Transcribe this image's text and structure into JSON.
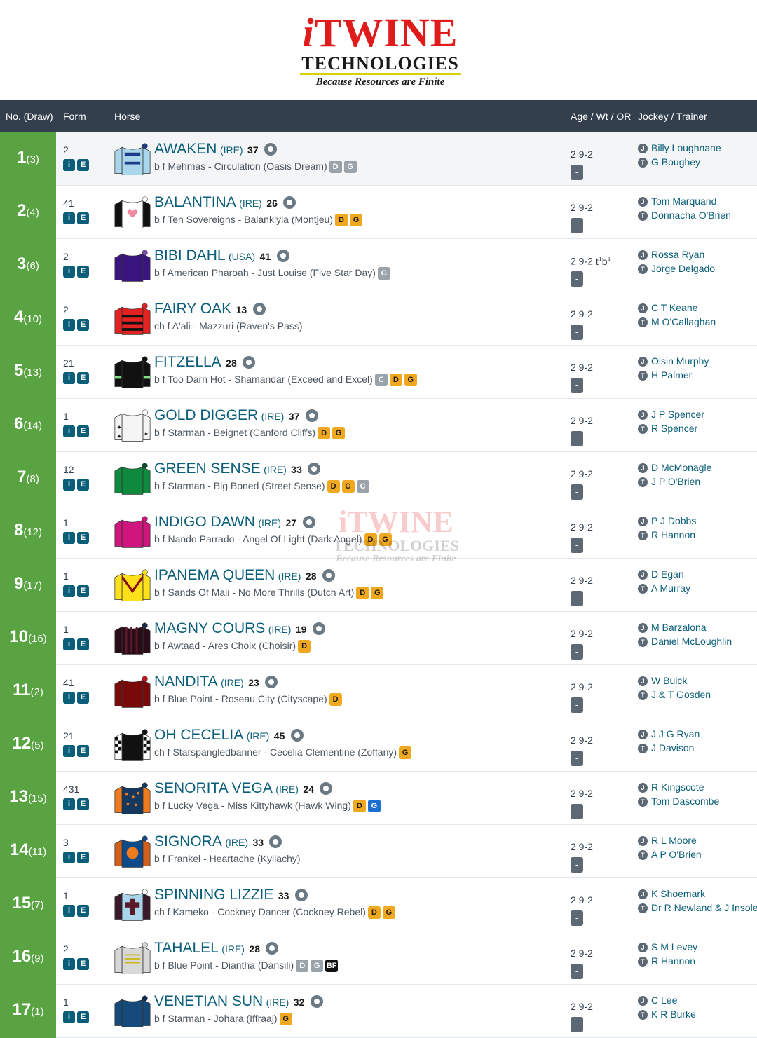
{
  "logo": {
    "main_prefix": "i",
    "main": "TWINE",
    "sub": "TECHNOLOGIES",
    "tagline": "Because Resources are Finite"
  },
  "header": {
    "no_draw": "No. (Draw)",
    "form": "Form",
    "horse": "Horse",
    "age_wt_or": "Age / Wt / OR",
    "jockey_trainer": "Jockey / Trainer"
  },
  "icons": {
    "i_label": "i",
    "e_label": "E",
    "jockey_icon": "J",
    "trainer_icon": "T",
    "or_value": "-"
  },
  "colors": {
    "number_cell": "#5aa343",
    "header_bg": "#333f4c",
    "link_teal": "#0a5e7a",
    "badge_orange": "#f0a820",
    "badge_grey": "#9aa3aa",
    "badge_blue": "#1a6fd0"
  },
  "runners": [
    {
      "num": "1",
      "draw": "(3)",
      "form": "2",
      "name": "AWAKEN",
      "country": "(IRE)",
      "rating": "37",
      "breeding": "b f Mehmas - Circulation (Oasis Dream)",
      "badges": [
        {
          "t": "D",
          "c": "g"
        },
        {
          "t": "G",
          "c": "g"
        }
      ],
      "age_wt": "2 9-2",
      "headgear": "",
      "jockey": "Billy Loughnane",
      "trainer": "G Boughey",
      "silk": {
        "body": "#a9d6ea",
        "sleeve": "#a9d6ea",
        "cap": "#1e3a8a",
        "accent": "#1e3a8a",
        "pattern": "sash"
      }
    },
    {
      "num": "2",
      "draw": "(4)",
      "form": "41",
      "name": "BALANTINA",
      "country": "(IRE)",
      "rating": "26",
      "breeding": "b f Ten Sovereigns - Balankiyla (Montjeu)",
      "badges": [
        {
          "t": "D",
          "c": "o"
        },
        {
          "t": "G",
          "c": "o"
        }
      ],
      "age_wt": "2 9-2",
      "headgear": "",
      "jockey": "Tom Marquand",
      "trainer": "Donnacha O'Brien",
      "silk": {
        "body": "#ffffff",
        "sleeve": "#111111",
        "cap": "#ffffff",
        "accent": "#f08aa0",
        "pattern": "heart"
      }
    },
    {
      "num": "3",
      "draw": "(6)",
      "form": "2",
      "name": "BIBI DAHL",
      "country": "(USA)",
      "rating": "41",
      "breeding": "b f American Pharoah - Just Louise (Five Star Day)",
      "badges": [
        {
          "t": "G",
          "c": "g"
        }
      ],
      "age_wt": "2 9-2",
      "headgear": "t1b1",
      "jockey": "Rossa Ryan",
      "trainer": "Jorge Delgado",
      "silk": {
        "body": "#3a1580",
        "sleeve": "#3a1580",
        "cap": "#7a4ab0",
        "accent": "#ffffff",
        "pattern": "plain"
      }
    },
    {
      "num": "4",
      "draw": "(10)",
      "form": "2",
      "name": "FAIRY OAK",
      "country": "",
      "rating": "13",
      "breeding": "ch f A'ali - Mazzuri (Raven's Pass)",
      "badges": [],
      "age_wt": "2 9-2",
      "headgear": "",
      "jockey": "C T Keane",
      "trainer": "M O'Callaghan",
      "silk": {
        "body": "#e52222",
        "sleeve": "#e52222",
        "cap": "#e52222",
        "accent": "#111111",
        "pattern": "hoops"
      }
    },
    {
      "num": "5",
      "draw": "(13)",
      "form": "21",
      "name": "FITZELLA",
      "country": "",
      "rating": "28",
      "breeding": "b f Too Darn Hot - Shamandar (Exceed and Excel)",
      "badges": [
        {
          "t": "C",
          "c": "g"
        },
        {
          "t": "D",
          "c": "o"
        },
        {
          "t": "G",
          "c": "o"
        }
      ],
      "age_wt": "2 9-2",
      "headgear": "",
      "jockey": "Oisin Murphy",
      "trainer": "H Palmer",
      "silk": {
        "body": "#111111",
        "sleeve": "#111111",
        "cap": "#111111",
        "accent": "#7fe08a",
        "pattern": "armlets"
      }
    },
    {
      "num": "6",
      "draw": "(14)",
      "form": "1",
      "name": "GOLD DIGGER",
      "country": "(IRE)",
      "rating": "37",
      "breeding": "b f Starman - Beignet (Canford Cliffs)",
      "badges": [
        {
          "t": "D",
          "c": "o"
        },
        {
          "t": "G",
          "c": "o"
        }
      ],
      "age_wt": "2 9-2",
      "headgear": "",
      "jockey": "J P Spencer",
      "trainer": "R Spencer",
      "silk": {
        "body": "#f5f5f5",
        "sleeve": "#f5f5f5",
        "cap": "#ffffff",
        "accent": "#111111",
        "pattern": "stars"
      }
    },
    {
      "num": "7",
      "draw": "(8)",
      "form": "12",
      "name": "GREEN SENSE",
      "country": "(IRE)",
      "rating": "33",
      "breeding": "b f Starman - Big Boned (Street Sense)",
      "badges": [
        {
          "t": "D",
          "c": "o"
        },
        {
          "t": "G",
          "c": "o"
        },
        {
          "t": "C",
          "c": "g"
        }
      ],
      "age_wt": "2 9-2",
      "headgear": "",
      "jockey": "D McMonagle",
      "trainer": "J P O'Brien",
      "silk": {
        "body": "#0d8a3e",
        "sleeve": "#0d8a3e",
        "cap": "#0b4f2a",
        "accent": "#0b4f2a",
        "pattern": "plain"
      }
    },
    {
      "num": "8",
      "draw": "(12)",
      "form": "1",
      "name": "INDIGO DAWN",
      "country": "(IRE)",
      "rating": "27",
      "breeding": "b f Nando Parrado - Angel Of Light (Dark Angel)",
      "badges": [
        {
          "t": "D",
          "c": "o"
        },
        {
          "t": "G",
          "c": "o"
        }
      ],
      "age_wt": "2 9-2",
      "headgear": "",
      "jockey": "P J Dobbs",
      "trainer": "R Hannon",
      "silk": {
        "body": "#d0157f",
        "sleeve": "#d0157f",
        "cap": "#d0157f",
        "accent": "#ffffff",
        "pattern": "plain"
      }
    },
    {
      "num": "9",
      "draw": "(17)",
      "form": "1",
      "name": "IPANEMA QUEEN",
      "country": "(IRE)",
      "rating": "28",
      "breeding": "b f Sands Of Mali - No More Thrills (Dutch Art)",
      "badges": [
        {
          "t": "D",
          "c": "o"
        },
        {
          "t": "G",
          "c": "o"
        }
      ],
      "age_wt": "2 9-2",
      "headgear": "",
      "jockey": "D Egan",
      "trainer": "A Murray",
      "silk": {
        "body": "#ffe11a",
        "sleeve": "#ffe11a",
        "cap": "#ffe11a",
        "accent": "#8a1010",
        "pattern": "chevron"
      }
    },
    {
      "num": "10",
      "draw": "(16)",
      "form": "1",
      "name": "MAGNY COURS",
      "country": "(IRE)",
      "rating": "19",
      "breeding": "b f Awtaad - Ares Choix (Choisir)",
      "badges": [
        {
          "t": "D",
          "c": "o"
        }
      ],
      "age_wt": "2 9-2",
      "headgear": "",
      "jockey": "M Barzalona",
      "trainer": "Daniel McLoughlin",
      "silk": {
        "body": "#2a0c18",
        "sleeve": "#2a0c18",
        "cap": "#1b2a4a",
        "accent": "#5a1a2a",
        "pattern": "stripes"
      }
    },
    {
      "num": "11",
      "draw": "(2)",
      "form": "41",
      "name": "NANDITA",
      "country": "(IRE)",
      "rating": "23",
      "breeding": "b f Blue Point - Roseau City (Cityscape)",
      "badges": [
        {
          "t": "D",
          "c": "o"
        }
      ],
      "age_wt": "2 9-2",
      "headgear": "",
      "jockey": "W Buick",
      "trainer": "J & T Gosden",
      "silk": {
        "body": "#7a0a0a",
        "sleeve": "#7a0a0a",
        "cap": "#c01818",
        "accent": "#7a0a0a",
        "pattern": "plain"
      }
    },
    {
      "num": "12",
      "draw": "(5)",
      "form": "21",
      "name": "OH CECELIA",
      "country": "(IRE)",
      "rating": "45",
      "breeding": "ch f Starspangledbanner - Cecelia Clementine (Zoffany)",
      "badges": [
        {
          "t": "G",
          "c": "o"
        }
      ],
      "age_wt": "2 9-2",
      "headgear": "",
      "jockey": "J J G Ryan",
      "trainer": "J Davison",
      "silk": {
        "body": "#111111",
        "sleeve": "#ffffff",
        "cap": "#111111",
        "accent": "#ffffff",
        "pattern": "check"
      }
    },
    {
      "num": "13",
      "draw": "(15)",
      "form": "431",
      "name": "SENORITA VEGA",
      "country": "(IRE)",
      "rating": "24",
      "breeding": "b f Lucky Vega - Miss Kittyhawk (Hawk Wing)",
      "badges": [
        {
          "t": "D",
          "c": "o"
        },
        {
          "t": "G",
          "c": "b"
        }
      ],
      "age_wt": "2 9-2",
      "headgear": "",
      "jockey": "R Kingscote",
      "trainer": "Tom Dascombe",
      "silk": {
        "body": "#14385e",
        "sleeve": "#f07a1e",
        "cap": "#14385e",
        "accent": "#f07a1e",
        "pattern": "spots"
      }
    },
    {
      "num": "14",
      "draw": "(11)",
      "form": "3",
      "name": "SIGNORA",
      "country": "(IRE)",
      "rating": "33",
      "breeding": "b f Frankel - Heartache (Kyllachy)",
      "badges": [],
      "age_wt": "2 9-2",
      "headgear": "",
      "jockey": "R L Moore",
      "trainer": "A P O'Brien",
      "silk": {
        "body": "#0d4a8a",
        "sleeve": "#d0601a",
        "cap": "#0d4a8a",
        "accent": "#f07a1e",
        "pattern": "disc"
      }
    },
    {
      "num": "15",
      "draw": "(7)",
      "form": "1",
      "name": "SPINNING LIZZIE",
      "country": "",
      "rating": "33",
      "breeding": "ch f Kameko - Cockney Dancer (Cockney Rebel)",
      "badges": [
        {
          "t": "D",
          "c": "o"
        },
        {
          "t": "G",
          "c": "o"
        }
      ],
      "age_wt": "2 9-2",
      "headgear": "",
      "jockey": "K Shoemark",
      "trainer": "Dr R Newland & J Insole",
      "silk": {
        "body": "#a9d6ea",
        "sleeve": "#3a1a2a",
        "cap": "#ffffff",
        "accent": "#5a1a2a",
        "pattern": "cross"
      }
    },
    {
      "num": "16",
      "draw": "(9)",
      "form": "2",
      "name": "TAHALEL",
      "country": "(IRE)",
      "rating": "28",
      "breeding": "b f Blue Point - Diantha (Dansili)",
      "badges": [
        {
          "t": "D",
          "c": "g"
        },
        {
          "t": "G",
          "c": "g"
        },
        {
          "t": "BF",
          "c": "k"
        }
      ],
      "age_wt": "2 9-2",
      "headgear": "",
      "jockey": "S M Levey",
      "trainer": "R Hannon",
      "silk": {
        "body": "#d8d8d8",
        "sleeve": "#d8d8d8",
        "cap": "#d8d8d8",
        "accent": "#c9b81a",
        "pattern": "bars"
      }
    },
    {
      "num": "17",
      "draw": "(1)",
      "form": "1",
      "name": "VENETIAN SUN",
      "country": "(IRE)",
      "rating": "32",
      "breeding": "b f Starman - Johara (Iffraaj)",
      "badges": [
        {
          "t": "G",
          "c": "o"
        }
      ],
      "age_wt": "2 9-2",
      "headgear": "",
      "jockey": "C Lee",
      "trainer": "K R Burke",
      "silk": {
        "body": "#154a7a",
        "sleeve": "#154a7a",
        "cap": "#0b2e55",
        "accent": "#0b2e55",
        "pattern": "plain"
      }
    }
  ],
  "watermark": {
    "main": "iTWINE",
    "sub": "TECHNOLOGIES",
    "tagline": "Because Resources are Finite"
  }
}
